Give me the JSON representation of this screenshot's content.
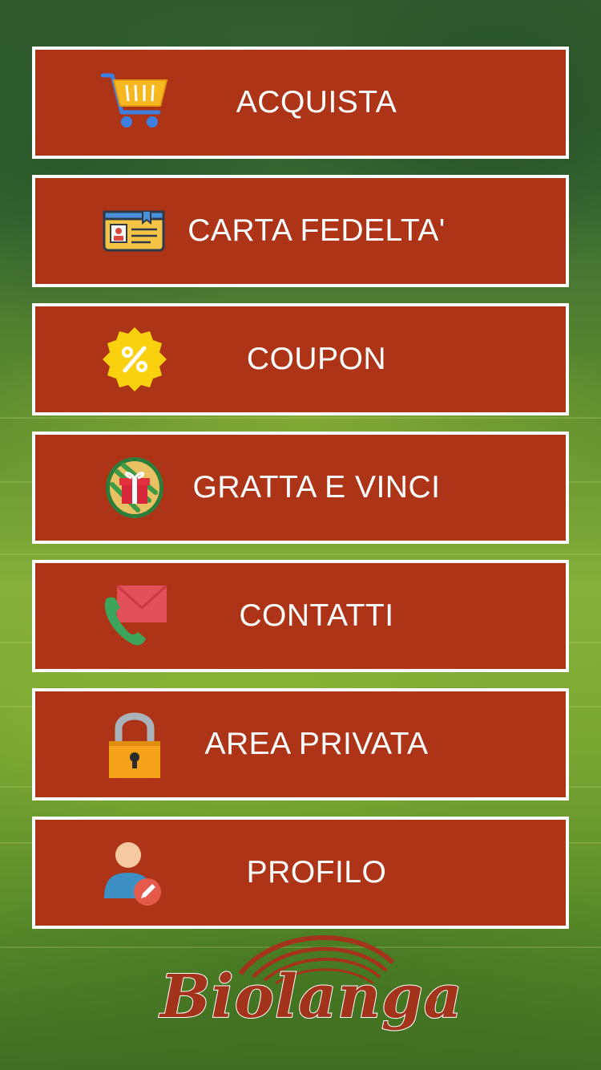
{
  "menu": [
    {
      "label": "ACQUISTA",
      "icon": "shopping-cart-icon"
    },
    {
      "label": "CARTA FEDELTA'",
      "icon": "loyalty-card-icon"
    },
    {
      "label": "COUPON",
      "icon": "percent-badge-icon"
    },
    {
      "label": "GRATTA E VINCI",
      "icon": "gift-scratch-icon"
    },
    {
      "label": "CONTATTI",
      "icon": "phone-mail-icon"
    },
    {
      "label": "AREA PRIVATA",
      "icon": "padlock-icon"
    },
    {
      "label": "PROFILO",
      "icon": "user-edit-icon"
    }
  ],
  "logo": {
    "text": "Biolanga",
    "mark": "®"
  },
  "colors": {
    "button": "#ad3417",
    "border": "#ffffff",
    "text": "#ffffff",
    "logo": "#a3341b"
  }
}
